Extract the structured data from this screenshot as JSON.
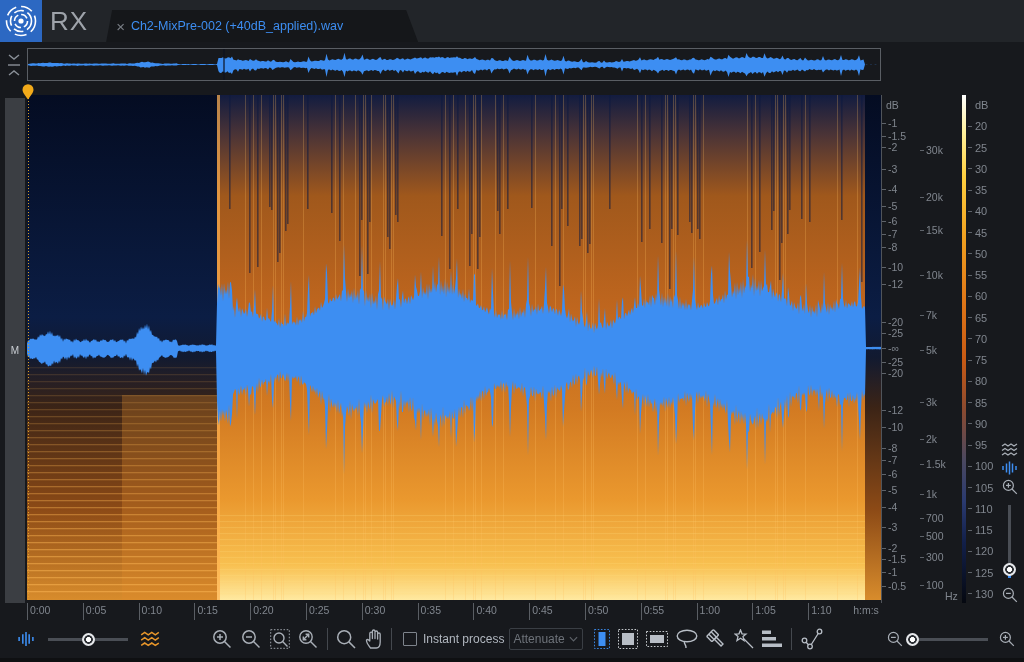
{
  "app": {
    "name": "RX"
  },
  "tabs": [
    {
      "label": "Ch2-MixPre-002 (+40dB_applied).wav",
      "close": "×",
      "selected": true
    }
  ],
  "editor": {
    "channel_label": "M",
    "amplitude_axis": {
      "unit": "dB",
      "ticks": [
        "-1",
        "-1.5",
        "-2",
        "-3",
        "-4",
        "-5",
        "-6",
        "-7",
        "-8",
        "-10",
        "-12",
        "-20",
        "-25",
        "-∞",
        "-25",
        "-20",
        "-12",
        "-10",
        "-8",
        "-7",
        "-6",
        "-5",
        "-4",
        "-3",
        "-2",
        "-1.5",
        "-1",
        "-0.5"
      ]
    },
    "frequency_axis": {
      "ticks": [
        "30k",
        "20k",
        "15k",
        "10k",
        "7k",
        "5k",
        "3k",
        "2k",
        "1.5k",
        "1k",
        "700",
        "500",
        "300",
        "100"
      ],
      "unit": "Hz"
    },
    "color_scale": {
      "unit": "dB",
      "ticks": [
        "20",
        "25",
        "30",
        "35",
        "40",
        "45",
        "50",
        "55",
        "60",
        "65",
        "70",
        "75",
        "80",
        "85",
        "90",
        "95",
        "100",
        "105",
        "110",
        "115",
        "120",
        "125",
        "130"
      ]
    },
    "time_axis": {
      "ticks": [
        "0:00",
        "0:05",
        "0:10",
        "0:15",
        "0:20",
        "0:25",
        "0:30",
        "0:35",
        "0:40",
        "0:45",
        "0:50",
        "0:55",
        "1:00",
        "1:05",
        "1:10"
      ],
      "unit": "h:m:s"
    }
  },
  "side_controls": {
    "scale_modes": [
      {
        "kind": "spectrogram",
        "selected": false
      },
      {
        "kind": "waveform",
        "selected": true
      }
    ],
    "vertical_zoom": {
      "level": 0.12
    }
  },
  "toolbar": {
    "blend_slider": {
      "level": 0.5
    },
    "instant_process": {
      "label": "Instant process",
      "checked": false
    },
    "mode_dropdown": {
      "value": "Attenuate",
      "disabled": true
    },
    "selection_tools": [
      {
        "kind": "time",
        "selected": true
      },
      {
        "kind": "time_frequency",
        "selected": false
      },
      {
        "kind": "frequency",
        "selected": false
      },
      {
        "kind": "lasso",
        "selected": false
      },
      {
        "kind": "brush",
        "selected": false
      },
      {
        "kind": "wand",
        "selected": false
      },
      {
        "kind": "harmonic",
        "selected": false
      }
    ],
    "draw_tools": [
      {
        "kind": "curve",
        "selected": false
      }
    ],
    "time_zoom": {
      "level": 0.06
    }
  }
}
